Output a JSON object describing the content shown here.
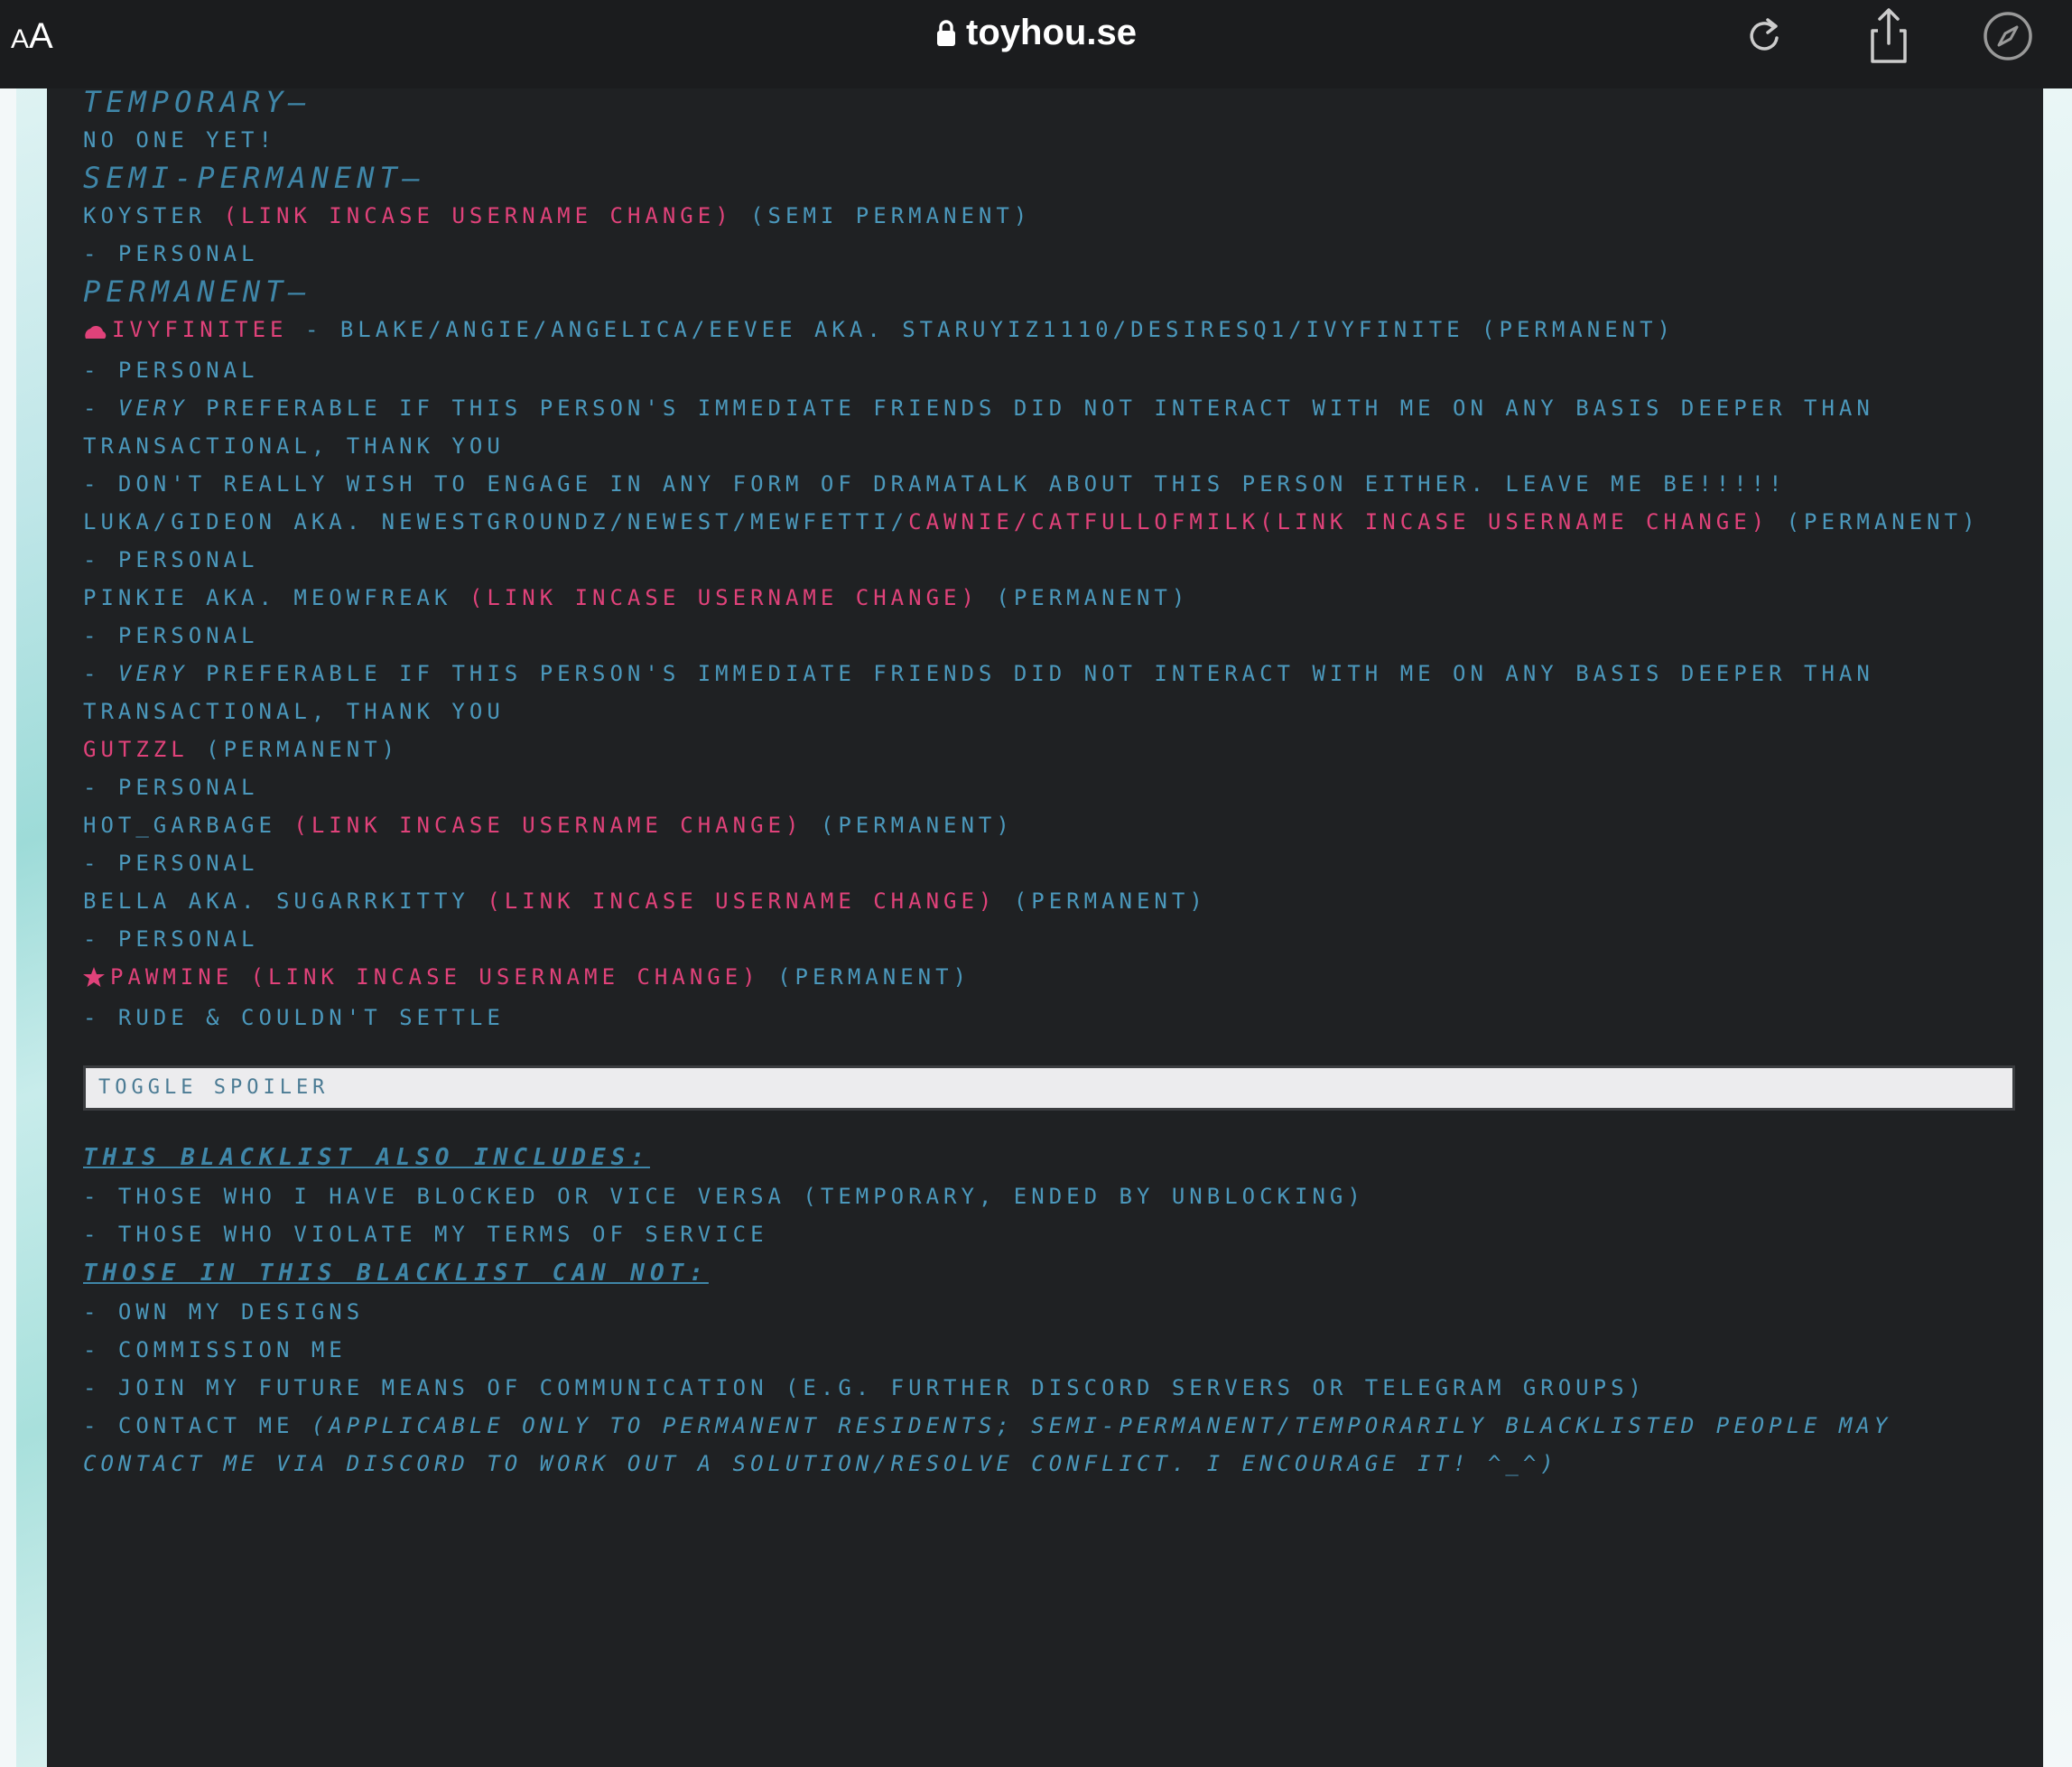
{
  "browser": {
    "aa_label_small": "A",
    "aa_label_big": "A",
    "url": "toyhou.se"
  },
  "sections": {
    "temporary": {
      "heading": "Temporary—",
      "lines": [
        "No one yet!"
      ]
    },
    "semi_permanent": {
      "heading": "Semi-Permanent—",
      "entry": {
        "name": "koyster",
        "link": "(link incase username change)",
        "status": "(semi permanent)",
        "note": "- personal"
      }
    },
    "permanent": {
      "heading": "Permanent—",
      "entries": [
        {
          "name": "ivyfinitee",
          "rest": " - blake/angie/angelica/eevee aka. staruyiz1110/desiresq1/ivyfinite (permanent)",
          "notes": [
            "- personal"
          ],
          "note_very_prefix": "- ",
          "note_very_em": "very",
          "note_very_rest": " preferable if this person's immediate friends did not interact with me on any basis deeper than transactional, thank you",
          "note_drama": "- don't really wish to engage in any form of dramatalk about this person either. leave me be!!!!!"
        },
        {
          "prefix": "luka/gideon aka. newestgroundz/newest/mewfetti/",
          "pink": "cawnie/catfullofmilk(link incase username change)",
          "status": " (permanent)",
          "note": "- personal"
        },
        {
          "prefix": "pinkie aka. meowfreak ",
          "pink": "(link incase username change)",
          "status": " (permanent)",
          "note": "- personal",
          "note_very_prefix": "- ",
          "note_very_em": "very",
          "note_very_rest": " preferable if this person's immediate friends did not interact with me on any basis deeper than transactional, thank you"
        },
        {
          "pink": "gutzzl",
          "status": " (permanent)",
          "note": "- personal"
        },
        {
          "prefix": "hot_garbage ",
          "pink": "(link incase username change)",
          "status": " (permanent)",
          "note": "- personal"
        },
        {
          "prefix": "bella aka. sugarrkitty ",
          "pink": "(link incase username change)",
          "status": " (permanent)",
          "note": "- personal"
        },
        {
          "pink": "pawmine (link incase username change)",
          "status": " (permanent)",
          "note": "- rude & couldn't settle"
        }
      ]
    },
    "spoiler_label": "Toggle Spoiler",
    "includes": {
      "heading": "This blacklist also includes:",
      "items": [
        "- those who i have blocked or vice versa (temporary, ended by unblocking)",
        "- those who violate my terms of service"
      ]
    },
    "cannot": {
      "heading": "Those in this blacklist can not:",
      "items": [
        "- own my designs",
        "- commission me",
        "- join my future means of communication (e.g. further discord servers or telegram groups)"
      ],
      "contact_prefix": "- contact me ",
      "contact_em": "(applicable only to permanent residents; semi-permanent/temporarily blacklisted people may contact me via discord to work out a solution/resolve conflict. i encourage it! ^_^)"
    }
  },
  "colors": {
    "text_blue": "#4b98bc",
    "link_pink": "#e0427a",
    "bg": "#1f2123"
  },
  "icons": [
    "lock-icon",
    "reload-icon",
    "share-icon",
    "compass-icon",
    "cloud-icon",
    "star-icon"
  ]
}
